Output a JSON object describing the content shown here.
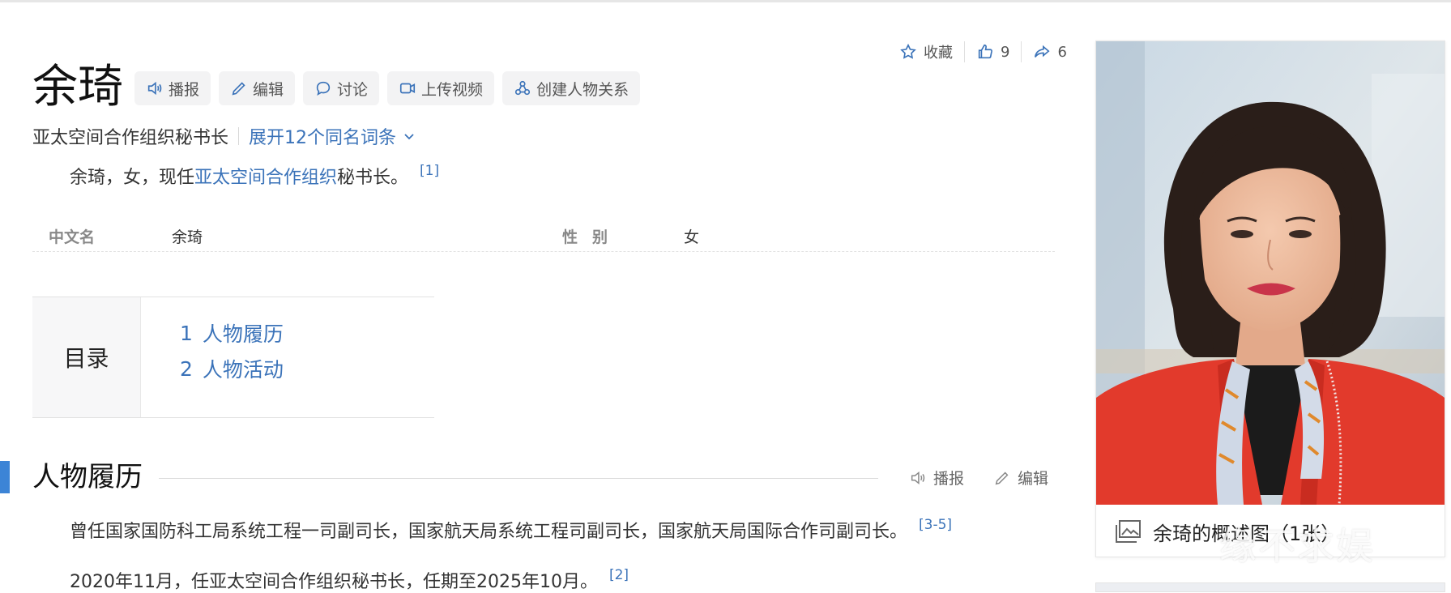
{
  "actions": {
    "favorite_label": "收藏",
    "like_count": "9",
    "share_count": "6"
  },
  "title": "余琦",
  "toolbar": {
    "broadcast": "播报",
    "edit": "编辑",
    "discuss": "讨论",
    "upload_video": "上传视频",
    "create_relation": "创建人物关系"
  },
  "subtitle": {
    "description": "亚太空间合作组织秘书长",
    "expand": "展开12个同名词条"
  },
  "summary": {
    "prefix": "余琦，女，现任",
    "link": "亚太空间合作组织",
    "suffix": "秘书长。",
    "ref": "[1]"
  },
  "basic_info": [
    {
      "key": "中文名",
      "value": "余琦"
    },
    {
      "key": "性别",
      "value": "女"
    }
  ],
  "toc": {
    "heading": "目录",
    "items": [
      {
        "num": "1",
        "label": "人物履历"
      },
      {
        "num": "2",
        "label": "人物活动"
      }
    ]
  },
  "section": {
    "title": "人物履历",
    "broadcast": "播报",
    "edit": "编辑",
    "paragraphs": [
      {
        "text": "曾任国家国防科工局系统工程一司副司长，国家航天局系统工程司副司长，国家航天局国际合作司副司长。",
        "ref": "[3-5]"
      },
      {
        "text": "2020年11月，任亚太空间合作组织秘书长，任期至2025年10月。",
        "ref": "[2]"
      }
    ]
  },
  "album": {
    "caption": "余琦的概述图（1张）"
  },
  "watermark": "缘不求娱",
  "colors": {
    "link": "#3b73b9",
    "accent_bar": "#3c84d6",
    "jacket": "#e23a2c"
  }
}
